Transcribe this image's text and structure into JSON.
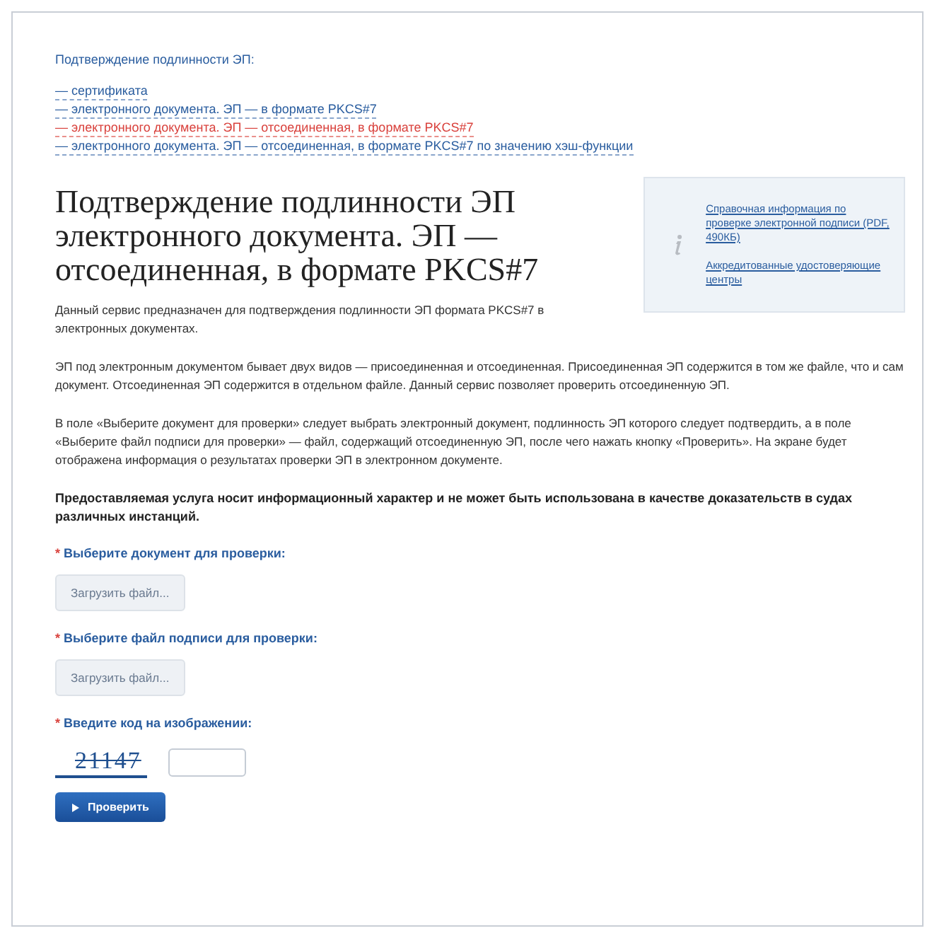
{
  "nav": {
    "title": "Подтверждение подлинности ЭП:",
    "links": [
      {
        "label": "— сертификата",
        "selected": false
      },
      {
        "label": "— электронного документа. ЭП — в формате PKCS#7",
        "selected": false
      },
      {
        "label": "— электронного документа. ЭП — отсоединенная, в формате PKCS#7",
        "selected": true
      },
      {
        "label": "— электронного документа. ЭП — отсоединенная, в формате PKCS#7 по значению хэш-функции",
        "selected": false
      }
    ]
  },
  "heading": "Подтверждение подлинности ЭП электронного документа. ЭП — отсоединенная, в формате PKCS#7",
  "intro": "Данный сервис предназначен для подтверждения подлинности ЭП формата PKCS#7 в электронных документах.",
  "info_box": {
    "links": [
      "Справочная информация по проверке электронной подписи (PDF, 490КБ)",
      "Аккредитованные удостоверяющие центры"
    ]
  },
  "paragraphs": [
    "ЭП под электронным документом бывает двух видов — присоединенная и отсоединенная. Присоединенная ЭП содержится в том же файле, что и сам документ. Отсоединенная ЭП содержится в отдельном файле. Данный сервис позволяет проверить отсоединенную ЭП.",
    "В поле «Выберите документ для проверки» следует выбрать электронный документ, подлинность ЭП которого следует подтвердить, а в поле «Выберите файл подписи для проверки» — файл, содержащий отсоединенную ЭП, после чего нажать кнопку «Проверить». На экране будет отображена информация о результатах проверки ЭП в электронном документе."
  ],
  "notice": "Предоставляемая услуга носит информационный характер и не может быть использована в качестве доказательств в судах различных инстанций.",
  "form": {
    "fields": [
      {
        "label": "Выберите документ для проверки:",
        "required_mark": "*",
        "kind": "file",
        "button": "Загрузить файл..."
      },
      {
        "label": "Выберите файл подписи для проверки:",
        "required_mark": "*",
        "kind": "file",
        "button": "Загрузить файл..."
      },
      {
        "label": "Введите код на изображении:",
        "required_mark": "*",
        "kind": "captcha",
        "captcha": "21147"
      }
    ],
    "submit": "Проверить"
  }
}
